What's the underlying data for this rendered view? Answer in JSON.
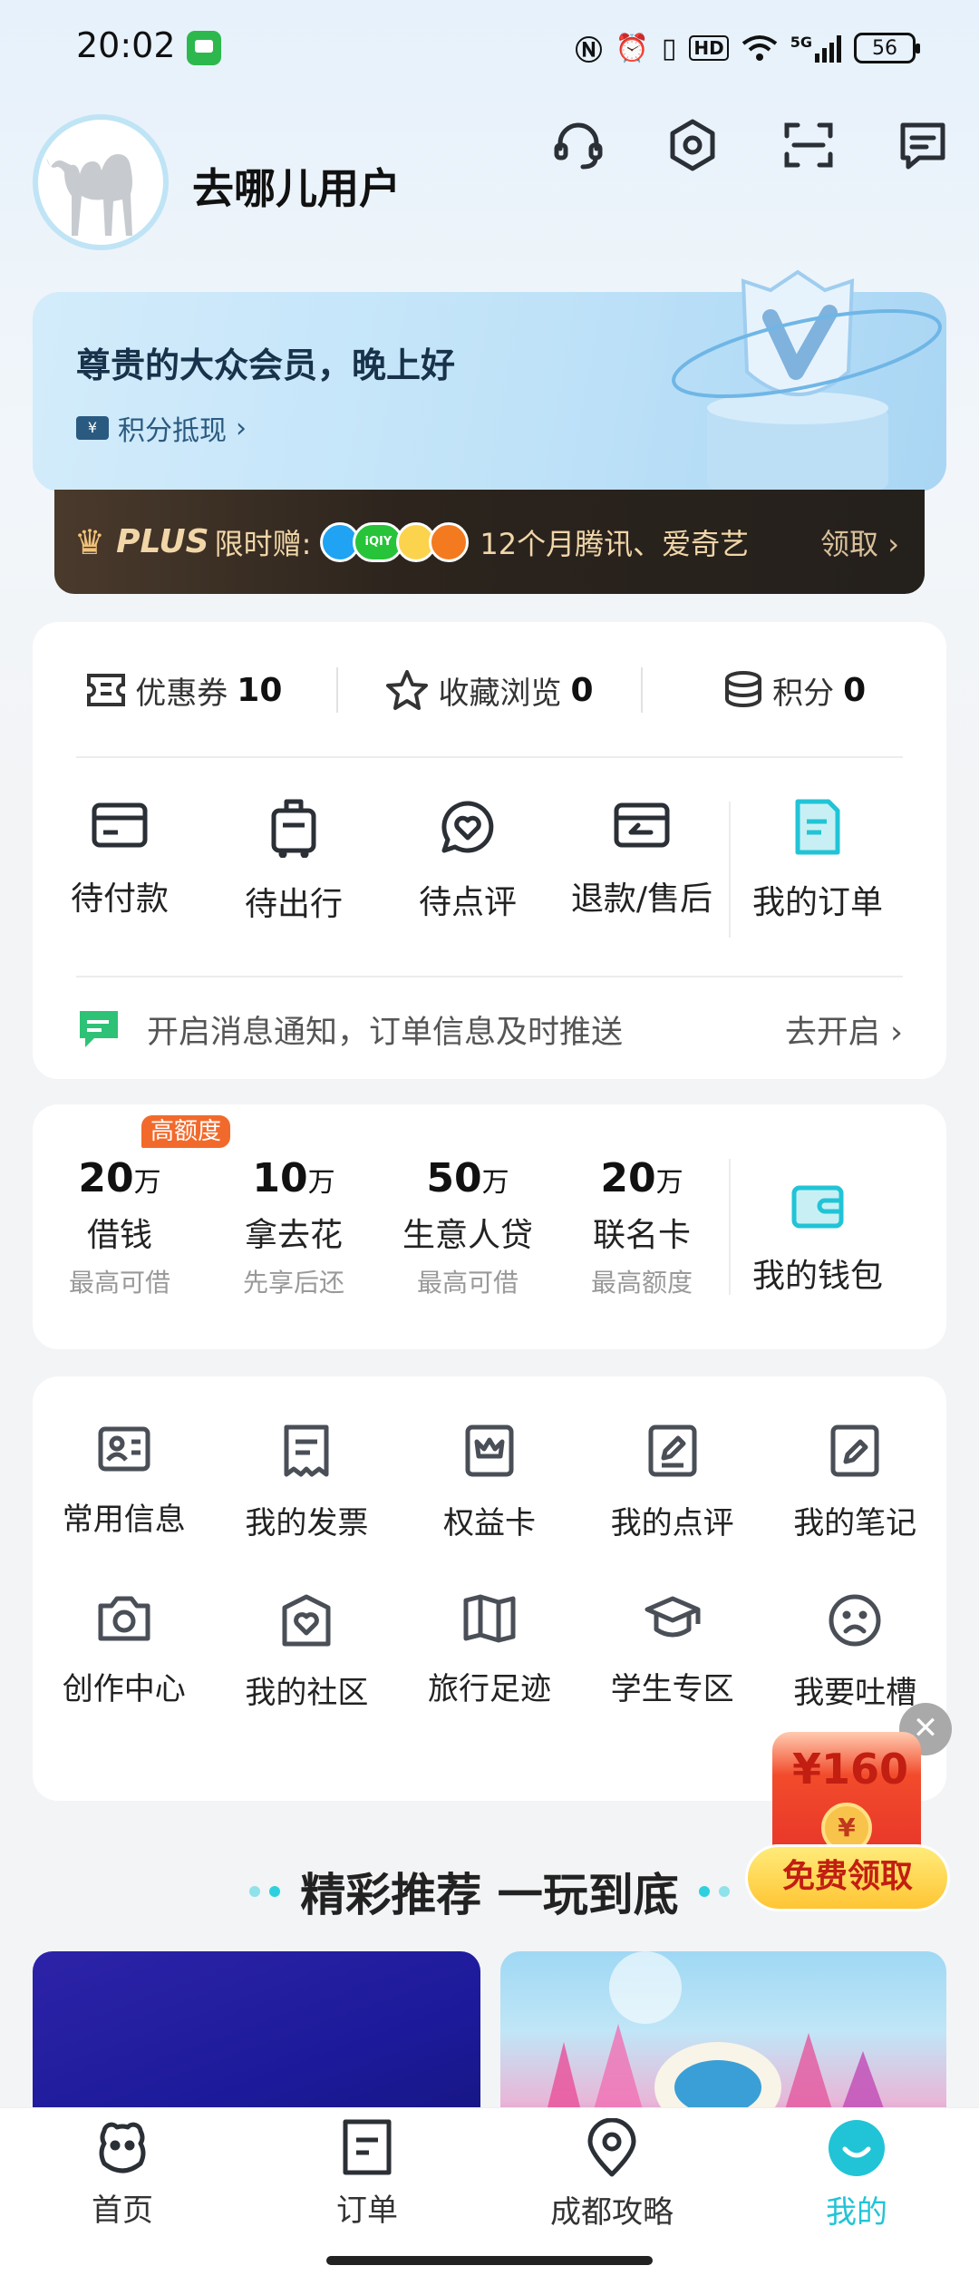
{
  "status_bar": {
    "time": "20:02",
    "battery": "56",
    "signal": "5G"
  },
  "header": {
    "username": "去哪儿用户"
  },
  "member": {
    "title": "尊贵的大众会员，晚上好",
    "points_link": "积分抵现",
    "points_tag": "¥"
  },
  "plus": {
    "brand": "PLUS",
    "gift": "限时赠:",
    "logo_iqiyi": "iQIY",
    "text": "12个月腾讯、爱奇艺",
    "claim": "领取"
  },
  "stats": [
    {
      "label": "优惠券",
      "value": "10"
    },
    {
      "label": "收藏浏览",
      "value": "0"
    },
    {
      "label": "积分",
      "value": "0"
    }
  ],
  "orders": [
    {
      "label": "待付款",
      "icon": "card-icon"
    },
    {
      "label": "待出行",
      "icon": "luggage-icon"
    },
    {
      "label": "待点评",
      "icon": "review-heart-icon"
    },
    {
      "label": "退款/售后",
      "icon": "refund-icon"
    },
    {
      "label": "我的订单",
      "icon": "order-doc-icon"
    }
  ],
  "notice": {
    "text": "开启消息通知，订单信息及时推送",
    "action": "去开启"
  },
  "wallet": {
    "hot_tag": "高额度",
    "items": [
      {
        "amount": "20",
        "unit": "万",
        "name": "借钱",
        "sub": "最高可借"
      },
      {
        "amount": "10",
        "unit": "万",
        "name": "拿去花",
        "sub": "先享后还"
      },
      {
        "amount": "50",
        "unit": "万",
        "name": "生意人贷",
        "sub": "最高可借"
      },
      {
        "amount": "20",
        "unit": "万",
        "name": "联名卡",
        "sub": "最高额度"
      }
    ],
    "my_wallet": "我的钱包"
  },
  "tools": [
    "常用信息",
    "我的发票",
    "权益卡",
    "我的点评",
    "我的笔记",
    "创作中心",
    "我的社区",
    "旅行足迹",
    "学生专区",
    "我要吐槽"
  ],
  "promo": {
    "amount": "¥160",
    "coin": "¥",
    "button": "免费领取",
    "close": "✕"
  },
  "recommend": {
    "title": "精彩推荐 一玩到底"
  },
  "tabs": [
    {
      "label": "首页",
      "icon": "home-mascot-icon"
    },
    {
      "label": "订单",
      "icon": "order-icon"
    },
    {
      "label": "成都攻略",
      "icon": "location-pin-icon"
    },
    {
      "label": "我的",
      "icon": "profile-smile-icon"
    }
  ],
  "colors": {
    "accent": "#21c4d6",
    "icon_gray": "#4a4f57",
    "plus_gold": "#f1d6a8",
    "hot_orange": "#f26a2b"
  }
}
